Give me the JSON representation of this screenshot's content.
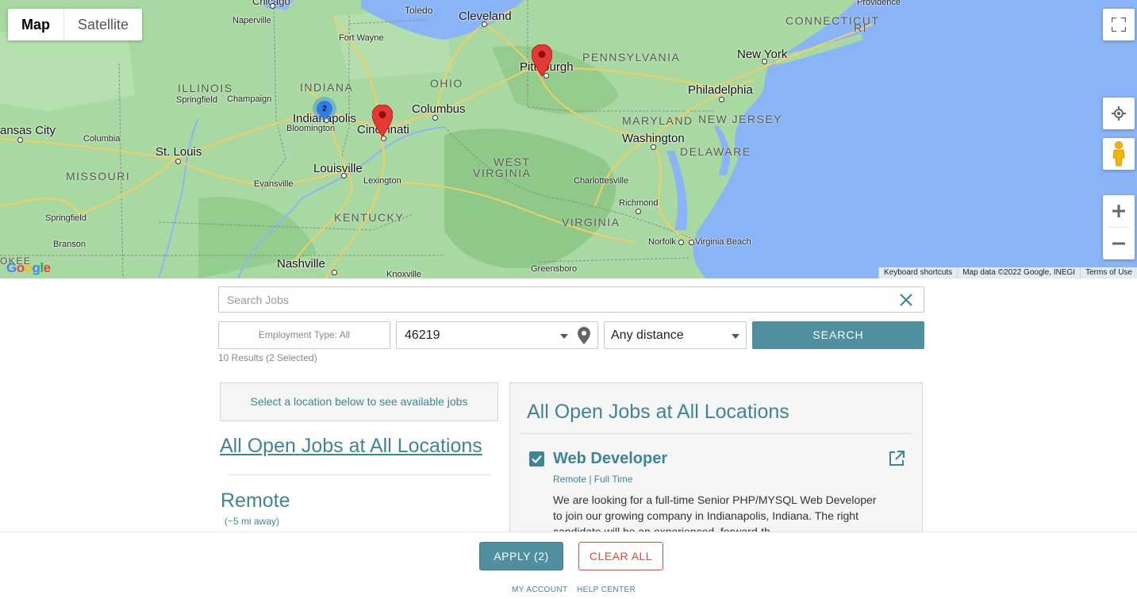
{
  "map": {
    "type_map": "Map",
    "type_satellite": "Satellite",
    "cluster_count": "2",
    "google": "Google",
    "attribution": {
      "keyboard": "Keyboard shortcuts",
      "data": "Map data ©2022 Google, INEGI",
      "terms": "Terms of Use"
    },
    "labels": {
      "chicago": "Chicago",
      "toledo": "Toledo",
      "cleveland": "Cleveland",
      "providence": "Providence",
      "connecticut": "CONNECTICUT",
      "ri": "RI",
      "naperville": "Naperville",
      "fort_wayne": "Fort Wayne",
      "pennsylvania": "PENNSYLVANIA",
      "new_york": "New York",
      "pittsburgh": "Pittsburgh",
      "illinois": "ILLINOIS",
      "indiana": "INDIANA",
      "ohio": "OHIO",
      "springfield_il": "Springfield",
      "champaign": "Champaign",
      "columbus": "Columbus",
      "philadelphia": "Philadelphia",
      "indianapolis": "Indianapolis",
      "bloomington": "Bloomington",
      "cincinnati": "Cincinnati",
      "kansas_city": "ansas City",
      "maryland": "MARYLAND",
      "new_jersey": "NEW JERSEY",
      "columbia": "Columbia",
      "washington": "Washington",
      "st_louis": "St. Louis",
      "delaware": "DELAWARE",
      "west": "WEST",
      "virginia_w": "VIRGINIA",
      "louisville": "Louisville",
      "missouri": "MISSOURI",
      "evansville": "Evansville",
      "lexington": "Lexington",
      "charlottesville": "Charlottesville",
      "richmond": "Richmond",
      "kentucky": "KENTUCKY",
      "springfield_mo": "Springfield",
      "virginia": "VIRGINIA",
      "norfolk": "Norfolk",
      "virginia_beach": "Virginia Beach",
      "branson": "Branson",
      "nashville": "Nashville",
      "greensboro": "Greensboro",
      "knoxville": "Knoxville",
      "okee": "OKEE"
    }
  },
  "search": {
    "placeholder": "Search Jobs",
    "employment_type": "Employment Type: All",
    "zip_value": "46219",
    "distance": "Any distance",
    "button": "SEARCH",
    "results": "10 Results (2 Selected)"
  },
  "locations": {
    "prompt": "Select a location below to see available jobs",
    "all_jobs": "All Open Jobs at All Locations",
    "remote_title": "Remote",
    "remote_distance": "(~5 mi away)"
  },
  "panel": {
    "title": "All Open Jobs at All Locations",
    "job": {
      "title": "Web Developer",
      "meta": "Remote | Full Time",
      "description": "We are looking for a full-time Senior PHP/MYSQL Web Developer to join our growing company in Indianapolis, Indiana. The right candidate will be an experienced, forward-th"
    }
  },
  "footer": {
    "apply": "APPLY (2)",
    "clear_all": "CLEAR ALL",
    "my_account": "MY ACCOUNT",
    "help_center": "HELP CENTER"
  },
  "colors": {
    "accent": "#3e8596",
    "button": "#4f8f9f",
    "danger": "#e04a3a",
    "water": "#8ab4f8",
    "land": "#a8d8a0",
    "pin": "#e53935"
  }
}
